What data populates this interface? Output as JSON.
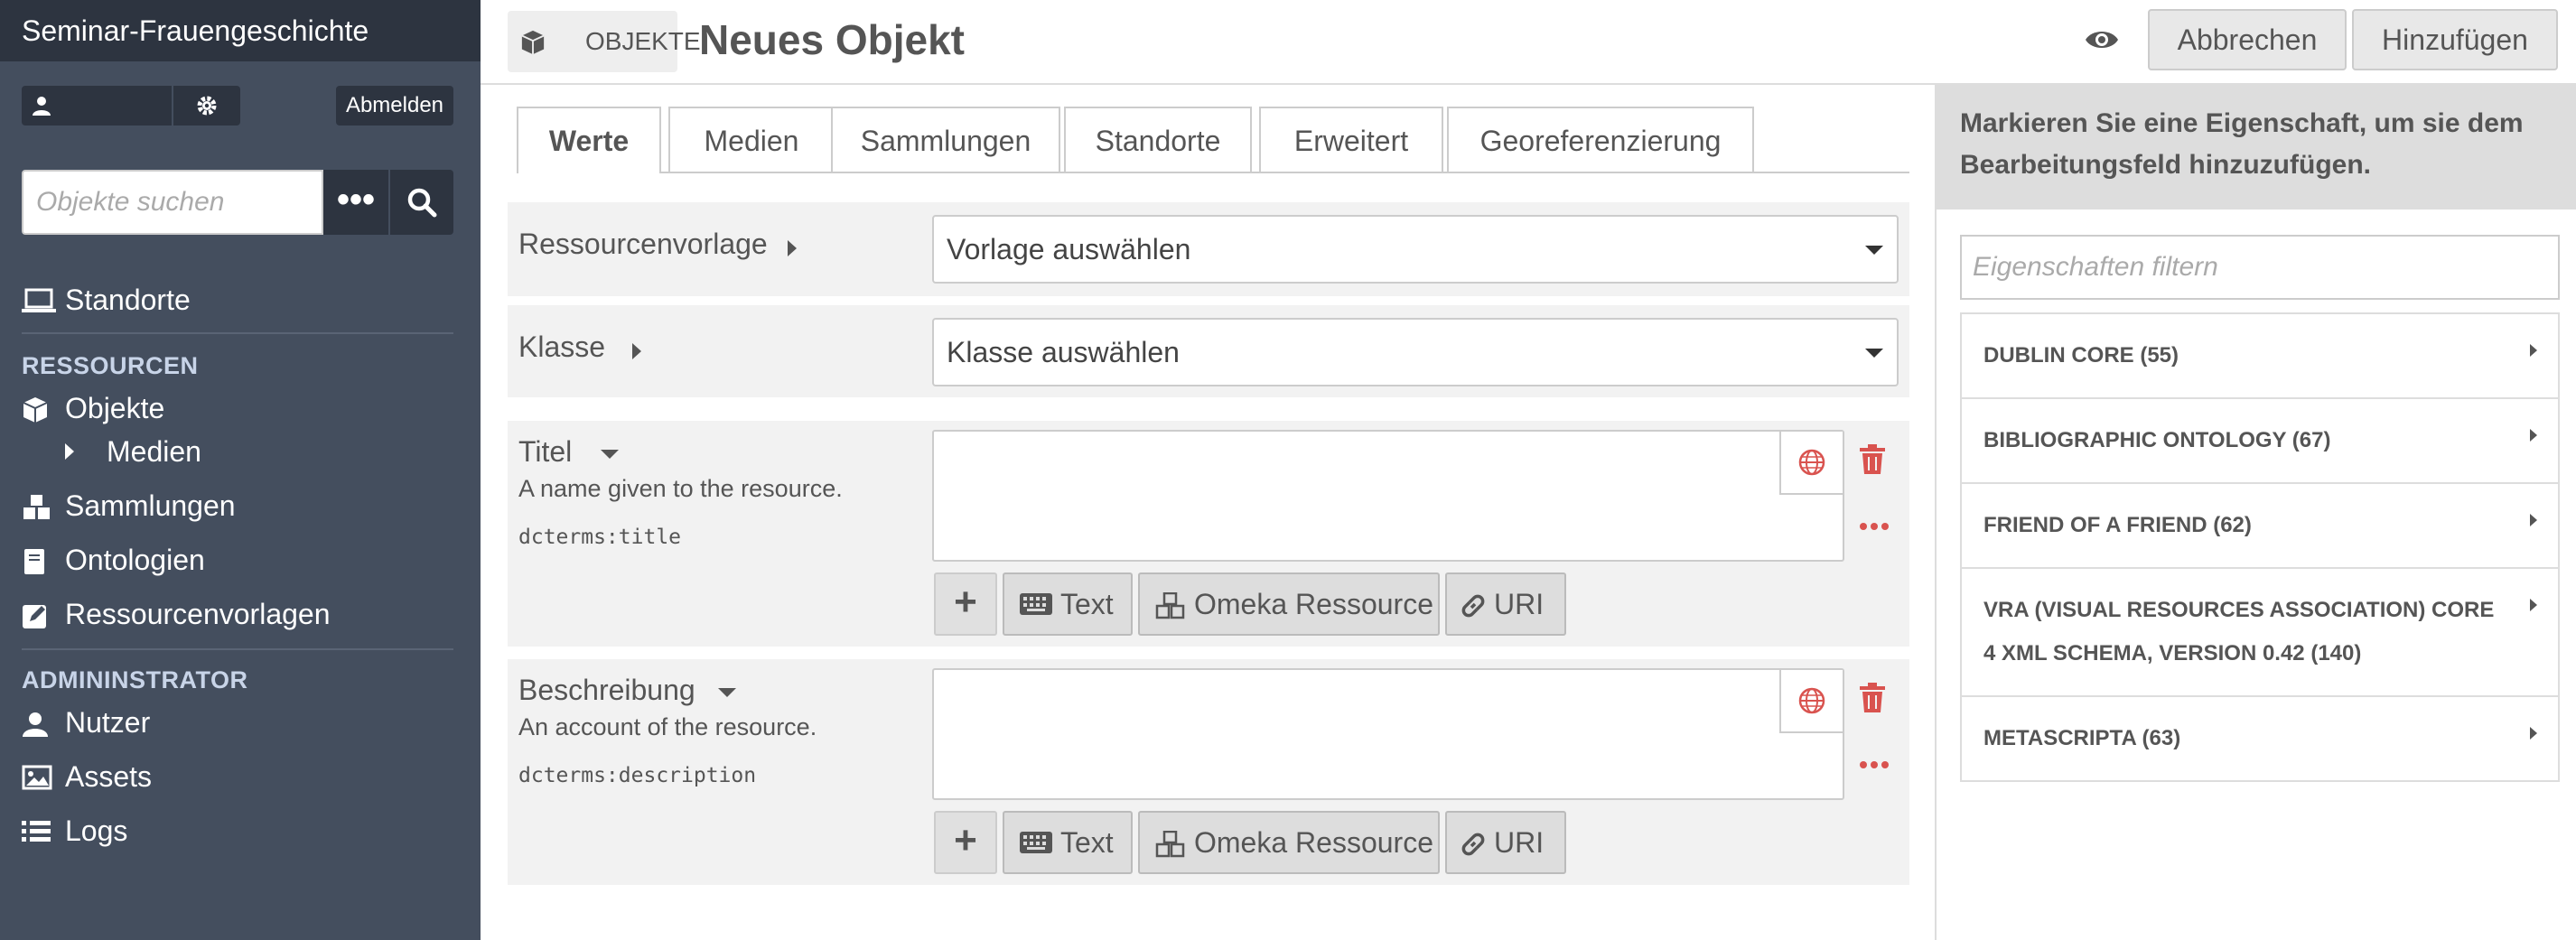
{
  "site": {
    "title": "Seminar-Frauengeschichte"
  },
  "user": {
    "logout_label": "Abmelden"
  },
  "search": {
    "placeholder": "Objekte suchen",
    "options_label": "•••"
  },
  "nav": {
    "standorte": "Standorte",
    "ressourcen_heading": "RESSOURCEN",
    "objekte": "Objekte",
    "medien": "Medien",
    "sammlungen": "Sammlungen",
    "ontologien": "Ontologien",
    "ressourcenvorlagen": "Ressourcenvorlagen",
    "admin_heading": "ADMININSTRATOR",
    "nutzer": "Nutzer",
    "assets": "Assets",
    "logs": "Logs"
  },
  "header": {
    "badge": "Objekte",
    "title": "Neues Objekt",
    "cancel_label": "Abbrechen",
    "add_label": "Hinzufügen"
  },
  "tabs": [
    "Werte",
    "Medien",
    "Sammlungen",
    "Standorte",
    "Erweitert",
    "Georeferenzierung"
  ],
  "form": {
    "template_label": "Ressourcenvorlage",
    "template_value": "Vorlage auswählen",
    "class_label": "Klasse",
    "class_value": "Klasse auswählen",
    "properties": [
      {
        "label": "Titel",
        "description": "A name given to the resource.",
        "term": "dcterms:title"
      },
      {
        "label": "Beschreibung",
        "description": "An account of the resource.",
        "term": "dcterms:description"
      }
    ],
    "buttons": {
      "text": "Text",
      "resource": "Omeka Ressource",
      "uri": "URI"
    }
  },
  "panel": {
    "message": "Markieren Sie eine Eigenschaft, um sie dem Bearbeitungsfeld hinzuzufügen.",
    "filter_placeholder": "Eigenschaften filtern",
    "vocabularies": [
      "DUBLIN CORE (55)",
      "BIBLIOGRAPHIC ONTOLOGY (67)",
      "FRIEND OF A FRIEND (62)",
      "VRA (VISUAL RESOURCES ASSOCIATION) CORE 4 XML SCHEMA, VERSION 0.42 (140)",
      "METASCRIPTA (63)"
    ]
  },
  "colors": {
    "sidebar": "#444e5e",
    "sidebar_dark": "#2d3440",
    "delete": "#d9534f",
    "accent_heading": "#c8d4e8"
  }
}
